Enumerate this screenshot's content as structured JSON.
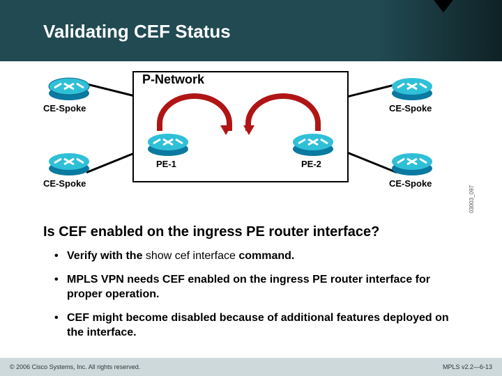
{
  "title": "Validating CEF Status",
  "diagram": {
    "p_network_label": "P-Network",
    "pe1_label": "PE-1",
    "pe2_label": "PE-2",
    "ce_top_left": "CE-Spoke",
    "ce_bottom_left": "CE-Spoke",
    "ce_top_right": "CE-Spoke",
    "ce_bottom_right": "CE-Spoke",
    "credit": "03003_097"
  },
  "question": "Is CEF enabled on the ingress PE router interface?",
  "bullets": [
    {
      "prefix": "Verify with the ",
      "cmd": "show cef interface ",
      "suffix": "command."
    },
    {
      "text": "MPLS VPN needs CEF enabled on the ingress PE router interface for proper operation."
    },
    {
      "text": "CEF might become disabled because of additional features deployed on the interface."
    }
  ],
  "footer": {
    "left": "© 2006 Cisco Systems, Inc. All rights reserved.",
    "right": "MPLS v2.2—6-13"
  }
}
